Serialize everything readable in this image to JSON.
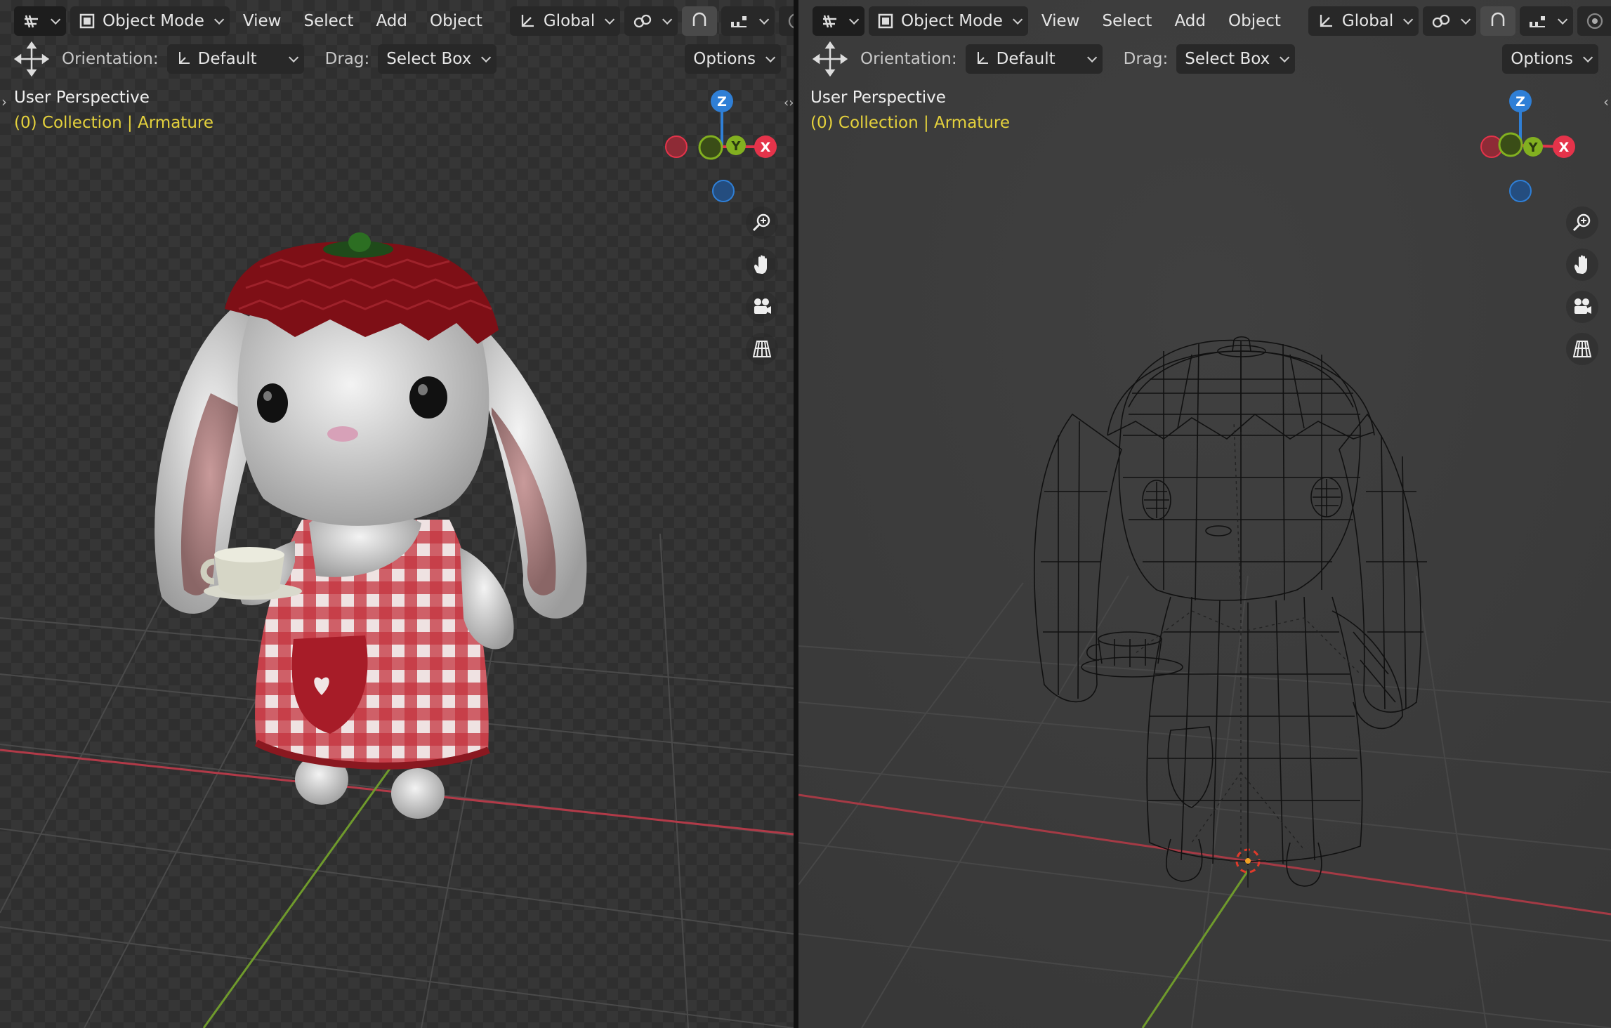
{
  "viewports": [
    {
      "id": "left",
      "header": {
        "editor_type_icon": "viewport-editor-icon",
        "mode_label": "Object Mode",
        "menus": [
          "View",
          "Select",
          "Add",
          "Object"
        ],
        "transform_orientation": "Global",
        "snap_icon": "snap-icon",
        "proportional_icon": "proportional-edit-icon"
      },
      "tool_settings": {
        "orientation_label": "Orientation:",
        "orientation_value": "Default",
        "drag_label": "Drag:",
        "drag_value": "Select Box",
        "options_label": "Options"
      },
      "overlay": {
        "perspective": "User Perspective",
        "collection": "(0) Collection | Armature"
      },
      "gizmo": {
        "z": "Z",
        "y": "Y",
        "x": "X"
      },
      "shading": "solid"
    },
    {
      "id": "right",
      "header": {
        "editor_type_icon": "viewport-editor-icon",
        "mode_label": "Object Mode",
        "menus": [
          "View",
          "Select",
          "Add",
          "Object"
        ],
        "transform_orientation": "Global",
        "snap_icon": "snap-icon",
        "proportional_icon": "proportional-edit-icon"
      },
      "tool_settings": {
        "orientation_label": "Orientation:",
        "orientation_value": "Default",
        "drag_label": "Drag:",
        "drag_value": "Select Box",
        "options_label": "Options"
      },
      "overlay": {
        "perspective": "User Perspective",
        "collection": "(0) Collection | Armature"
      },
      "gizmo": {
        "z": "Z",
        "y": "Y",
        "x": "X"
      },
      "shading": "wireframe"
    }
  ],
  "colors": {
    "viewport_bg": "#3d3d3d",
    "x_axis": "#e5334a",
    "y_axis": "#82b020",
    "z_axis": "#2f7fd6",
    "collection_text": "#e4d13c",
    "dress_red": "#b4202c",
    "hat_red": "#7e0f16"
  }
}
